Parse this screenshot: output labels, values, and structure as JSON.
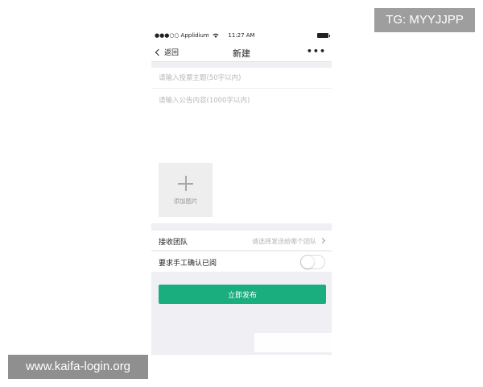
{
  "watermarks": {
    "telegram": "TG: MYYJJPP",
    "site": "www.kaifa-login.org"
  },
  "status_bar": {
    "signal": "●●●○○",
    "carrier": "Applidium",
    "wifi_icon": "wifi-icon",
    "time": "11:27 AM",
    "battery_icon": "battery-icon"
  },
  "nav": {
    "back_label": "返回",
    "title": "新建",
    "more_label": "•••"
  },
  "form": {
    "topic_placeholder": "请输入投票主题(50字以内)",
    "topic_value": "",
    "content_placeholder": "请输入公告内容(1000字以内)",
    "content_value": "",
    "add_image_label": "添加图片"
  },
  "team_row": {
    "label": "接收团队",
    "value_placeholder": "请选择发送给哪个团队"
  },
  "confirm_row": {
    "label": "要求手工确认已阅",
    "toggle_on": false
  },
  "publish_label": "立即发布",
  "colors": {
    "accent": "#1aad7e",
    "background": "#efeff4",
    "placeholder": "#b9b9b9"
  }
}
